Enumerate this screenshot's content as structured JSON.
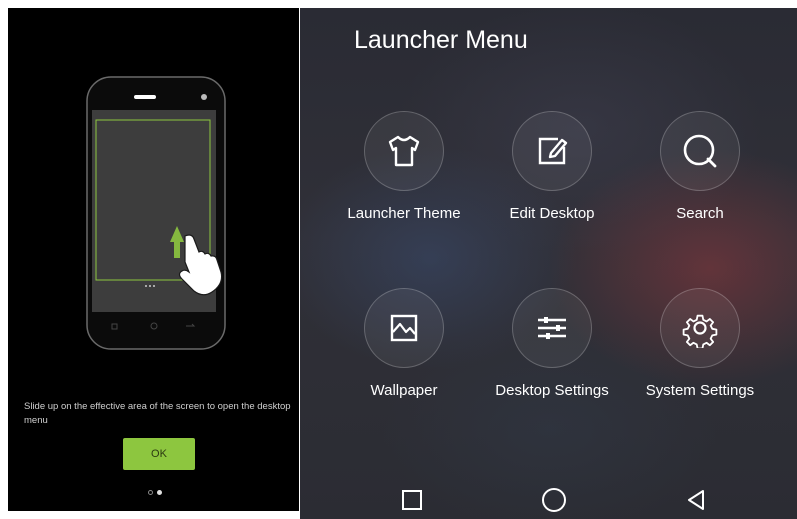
{
  "tutorial": {
    "hint_text": "Slide up on the effective area of the screen to open the desktop menu",
    "ok_label": "OK",
    "page_count": 2,
    "active_page": 2
  },
  "launcher": {
    "title": "Launcher Menu",
    "items": [
      {
        "label": "Launcher Theme",
        "icon": "tshirt-icon"
      },
      {
        "label": "Edit Desktop",
        "icon": "edit-icon"
      },
      {
        "label": "Search",
        "icon": "search-icon"
      },
      {
        "label": "Wallpaper",
        "icon": "wallpaper-icon"
      },
      {
        "label": "Desktop Settings",
        "icon": "sliders-icon"
      },
      {
        "label": "System Settings",
        "icon": "gear-icon"
      }
    ]
  },
  "navbar": {
    "buttons": [
      "recent-apps-icon",
      "home-icon",
      "back-icon"
    ]
  },
  "colors": {
    "accent_green": "#8dc63f",
    "left_background": "#000000",
    "text_white": "#ffffff"
  }
}
